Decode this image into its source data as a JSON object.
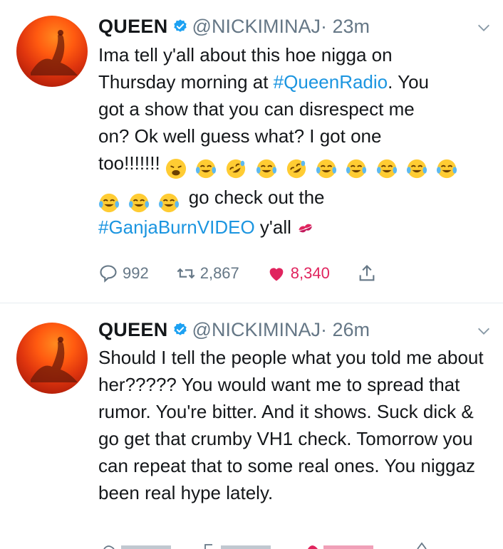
{
  "tweets": [
    {
      "name": "QUEEN",
      "handle": "@NICKIMINAJ",
      "time": "· 23m",
      "text_parts": {
        "line1": "Ima tell y'all about this hoe nigga on",
        "line2a": "Thursday morning at ",
        "hashtag1": "#QueenRadio",
        "line2b": ". You",
        "line3": "got a show that you can disrespect me",
        "line4": "on? Ok well guess what? I got one",
        "line5": "too!!!!!!! ",
        "line6": " go check out the",
        "hashtag2": "#GanjaBurnVIDEO",
        "line7": " y'all "
      },
      "replies": "992",
      "retweets": "2,867",
      "likes": "8,340"
    },
    {
      "name": "QUEEN",
      "handle": "@NICKIMINAJ",
      "time": "· 26m",
      "text": "Should I tell the people what you told me about her????? You would want me to spread that rumor. You're bitter. And it shows. Suck dick & go get that crumby VH1 check. Tomorrow you can repeat that to some real ones. You niggaz been real hype lately."
    }
  ],
  "icons": {
    "verified": "verified-badge-icon",
    "more": "chevron-down-icon",
    "reply": "reply-icon",
    "retweet": "retweet-icon",
    "like": "heart-icon",
    "share": "share-icon",
    "emoji_weary": "weary-face-emoji",
    "emoji_joy": "tears-of-joy-emoji",
    "emoji_rofl": "rofl-emoji",
    "emoji_kiss": "kiss-mark-emoji"
  },
  "colors": {
    "link": "#1b95e0",
    "like": "#e0245e",
    "verified": "#1da1f2",
    "muted": "#657786"
  }
}
